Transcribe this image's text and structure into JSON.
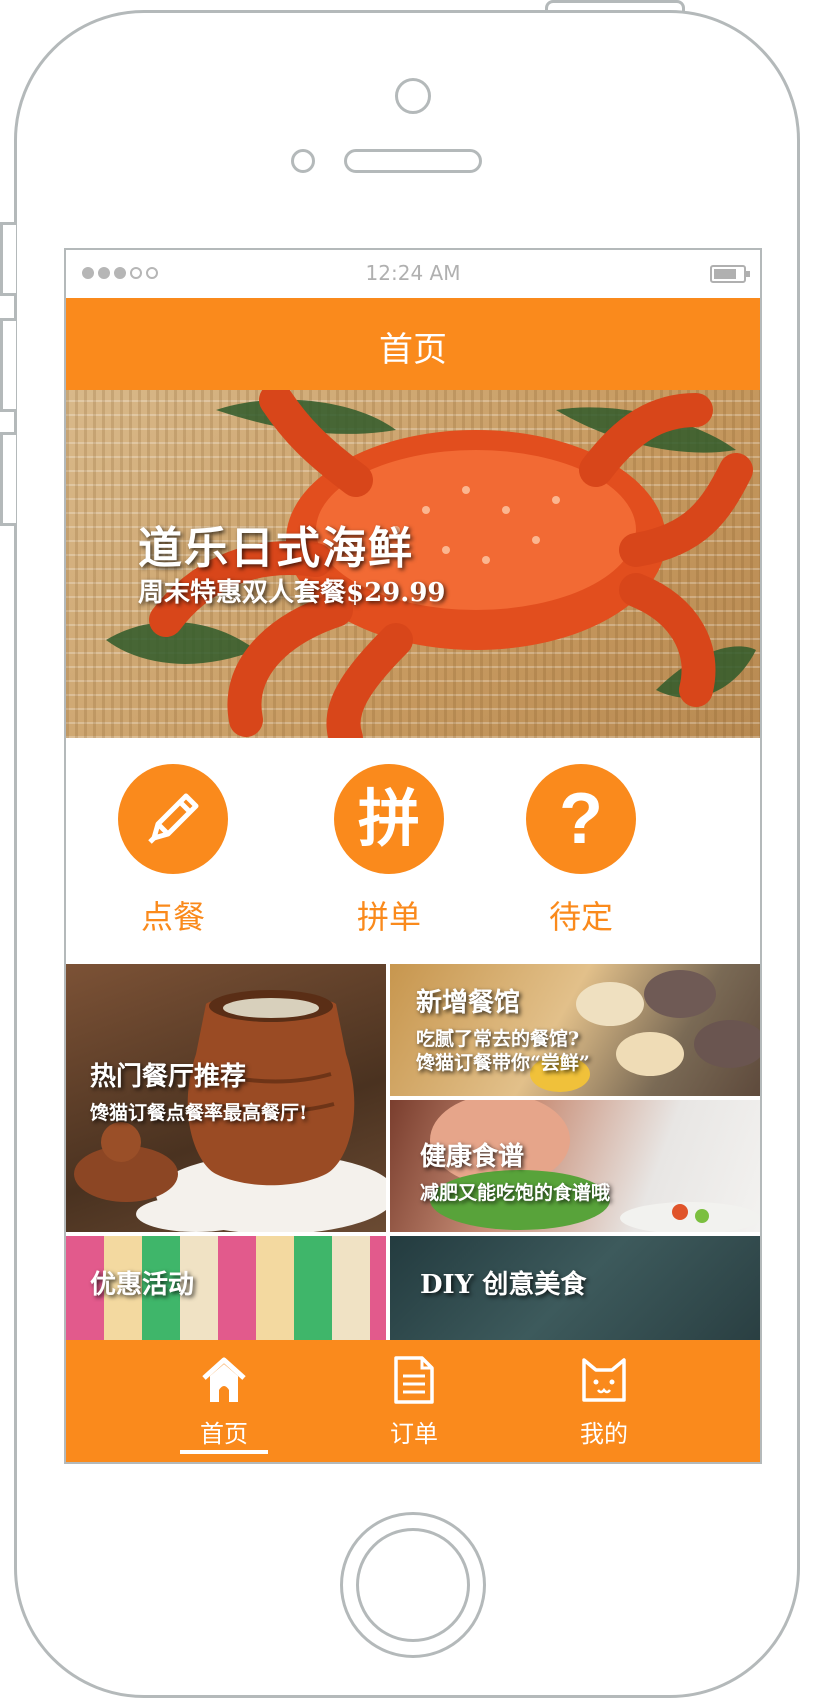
{
  "status_bar": {
    "time": "12:24 AM"
  },
  "header": {
    "title": "首页"
  },
  "banner": {
    "title": "道乐日式海鲜",
    "subtitle": "周末特惠双人套餐$29.99"
  },
  "actions": [
    {
      "label": "点餐",
      "icon": "pencil-icon"
    },
    {
      "label": "拼单",
      "icon": "pin-glyph-icon",
      "glyph": "拼"
    },
    {
      "label": "待定",
      "icon": "question-icon",
      "glyph": "?"
    }
  ],
  "tiles": {
    "hot": {
      "title": "热门餐厅推荐",
      "subtitle": "馋猫订餐点餐率最高餐厅!"
    },
    "new": {
      "title": "新增餐馆",
      "subtitle_line1": "吃腻了常去的餐馆?",
      "subtitle_line2": "馋猫订餐带你“尝鲜”"
    },
    "health": {
      "title": "健康食谱",
      "subtitle": "减肥又能吃饱的食谱哦"
    },
    "promo": {
      "title": "优惠活动"
    },
    "diy": {
      "title": "DIY 创意美食"
    }
  },
  "tab_bar": {
    "items": [
      {
        "label": "首页",
        "icon": "home-icon",
        "active": true
      },
      {
        "label": "订单",
        "icon": "document-icon",
        "active": false
      },
      {
        "label": "我的",
        "icon": "cat-face-icon",
        "active": false
      }
    ]
  },
  "colors": {
    "accent": "#fa8a1c",
    "frame": "#b4b9ba"
  }
}
